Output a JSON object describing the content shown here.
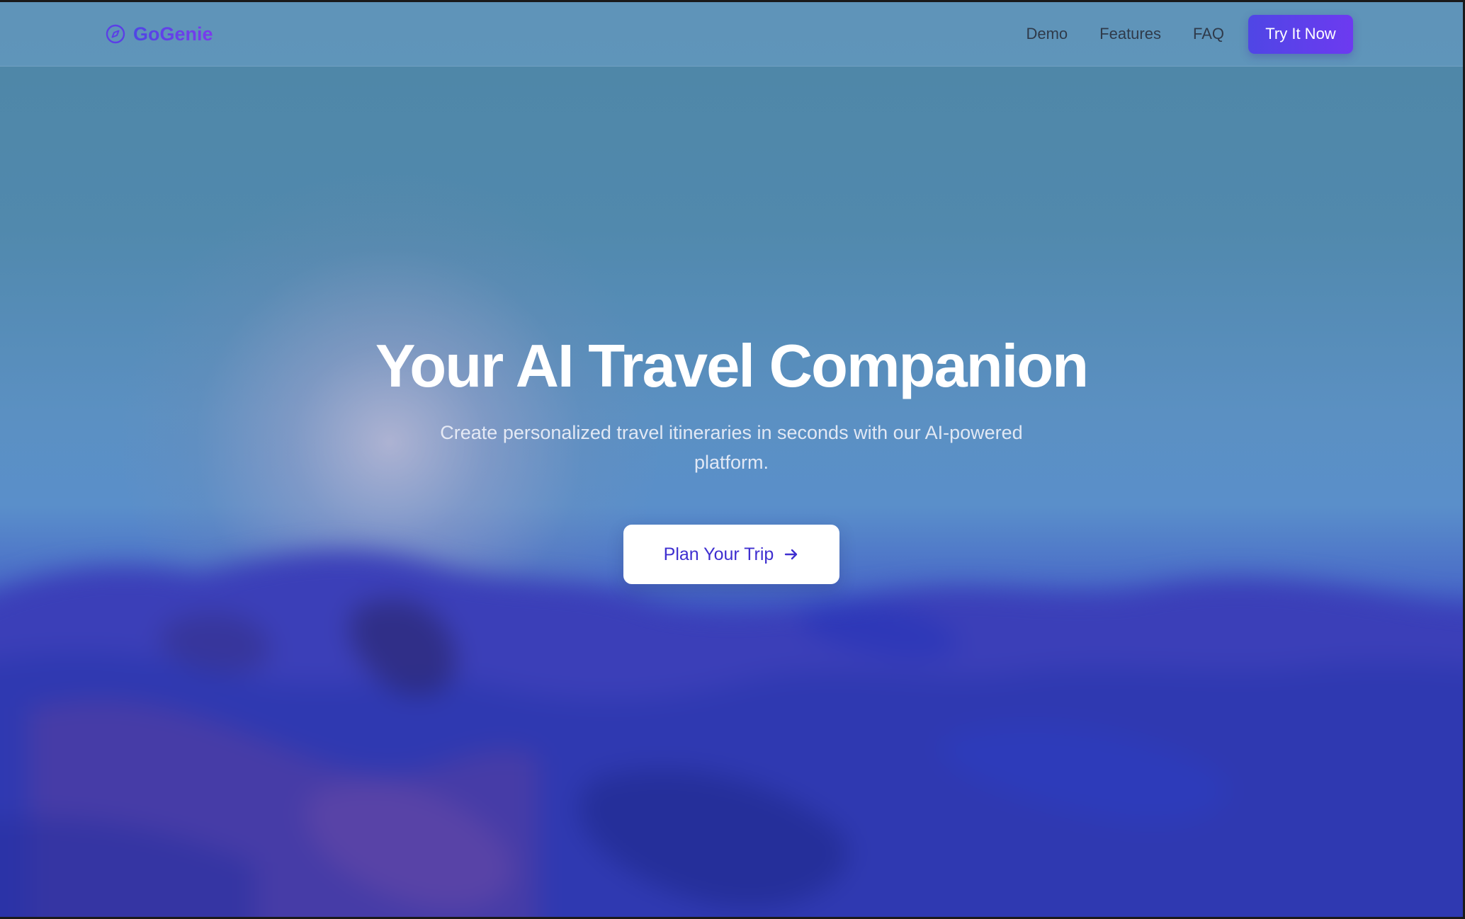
{
  "brand": {
    "name": "GoGenie",
    "icon": "compass-icon",
    "colors": [
      "#4f46e5",
      "#7c3aed"
    ]
  },
  "nav": {
    "links": [
      {
        "label": "Demo"
      },
      {
        "label": "Features"
      },
      {
        "label": "FAQ"
      }
    ],
    "cta_label": "Try It Now"
  },
  "hero": {
    "title": "Your AI Travel Companion",
    "subtitle": "Create personalized travel itineraries in seconds with our AI-powered platform.",
    "button_label": "Plan Your Trip",
    "button_icon": "arrow-right-icon"
  },
  "colors": {
    "accent": "#4f46e5",
    "accent_purple": "#6d3af0",
    "sky": "#5a8fca",
    "hills": "#2f3fc0"
  }
}
